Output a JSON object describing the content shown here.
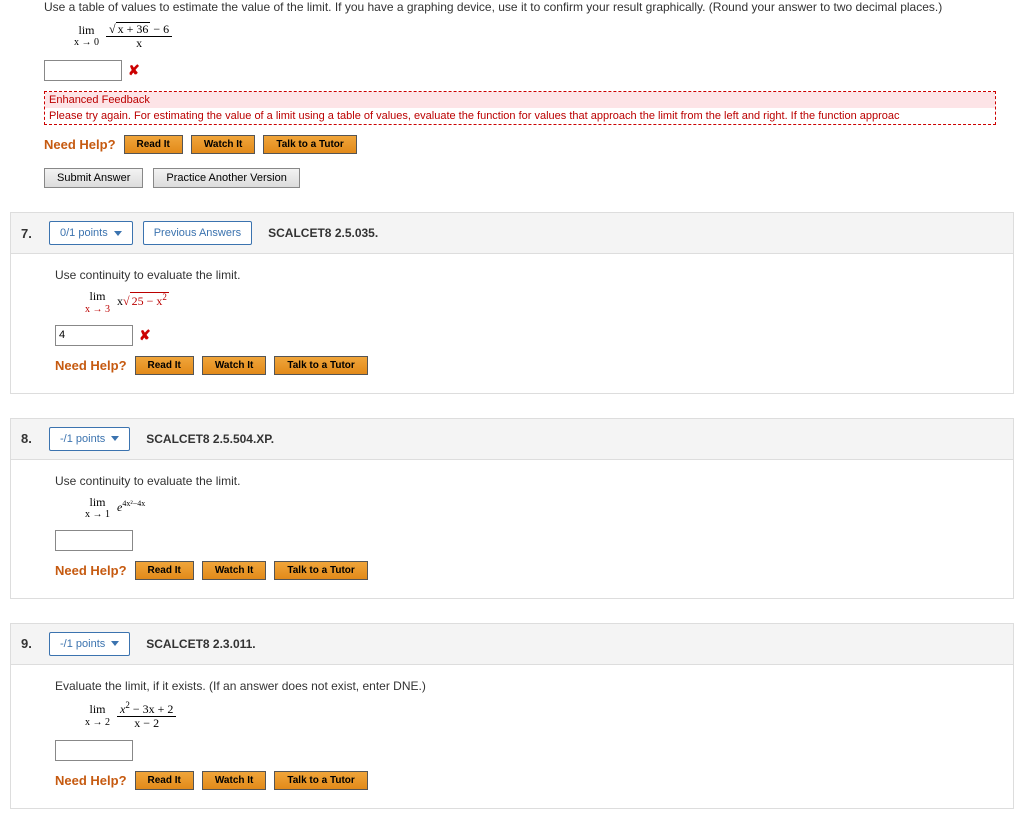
{
  "top_question": {
    "prompt": "Use a table of values to estimate the value of the limit. If you have a graphing device, use it to confirm your result graphically. (Round your answer to two decimal places.)",
    "math": {
      "lim_label": "lim",
      "lim_sub": "x → 0",
      "num_sqrt": "x + 36",
      "num_tail": " − 6",
      "den": "x"
    },
    "answer_value": "",
    "feedback": {
      "head": "Enhanced Feedback",
      "body": "Please try again. For estimating the value of a limit using a table of values, evaluate the function for values that approach the limit from the left and right. If the function approac"
    },
    "need_help": "Need Help?",
    "help_buttons": {
      "read": "Read It",
      "watch": "Watch It",
      "tutor": "Talk to a Tutor"
    },
    "submit": "Submit Answer",
    "practice": "Practice Another Version"
  },
  "q7": {
    "number": "7.",
    "points": "0/1 points",
    "prev": "Previous Answers",
    "source": "SCALCET8 2.5.035.",
    "prompt": "Use continuity to evaluate the limit.",
    "math": {
      "lim_label": "lim",
      "lim_sub": "x → 3",
      "lead": "x",
      "sqrt_inner": "25 − x",
      "sqrt_sup": "2"
    },
    "answer_value": "4",
    "need_help": "Need Help?",
    "help_buttons": {
      "read": "Read It",
      "watch": "Watch It",
      "tutor": "Talk to a Tutor"
    }
  },
  "q8": {
    "number": "8.",
    "points": "-/1 points",
    "source": "SCALCET8 2.5.504.XP.",
    "prompt": "Use continuity to evaluate the limit.",
    "math": {
      "lim_label": "lim",
      "lim_sub": "x → 1",
      "expr": "e",
      "exp_sup": "4x²−4x"
    },
    "answer_value": "",
    "need_help": "Need Help?",
    "help_buttons": {
      "read": "Read It",
      "watch": "Watch It",
      "tutor": "Talk to a Tutor"
    }
  },
  "q9": {
    "number": "9.",
    "points": "-/1 points",
    "source": "SCALCET8 2.3.011.",
    "prompt": "Evaluate the limit, if it exists. (If an answer does not exist, enter DNE.)",
    "math": {
      "lim_label": "lim",
      "lim_sub": "x → 2",
      "num_a": "x",
      "num_sup": "2",
      "num_b": " − 3x + 2",
      "den": "x − 2"
    },
    "answer_value": "",
    "need_help": "Need Help?",
    "help_buttons": {
      "read": "Read It",
      "watch": "Watch It",
      "tutor": "Talk to a Tutor"
    }
  }
}
